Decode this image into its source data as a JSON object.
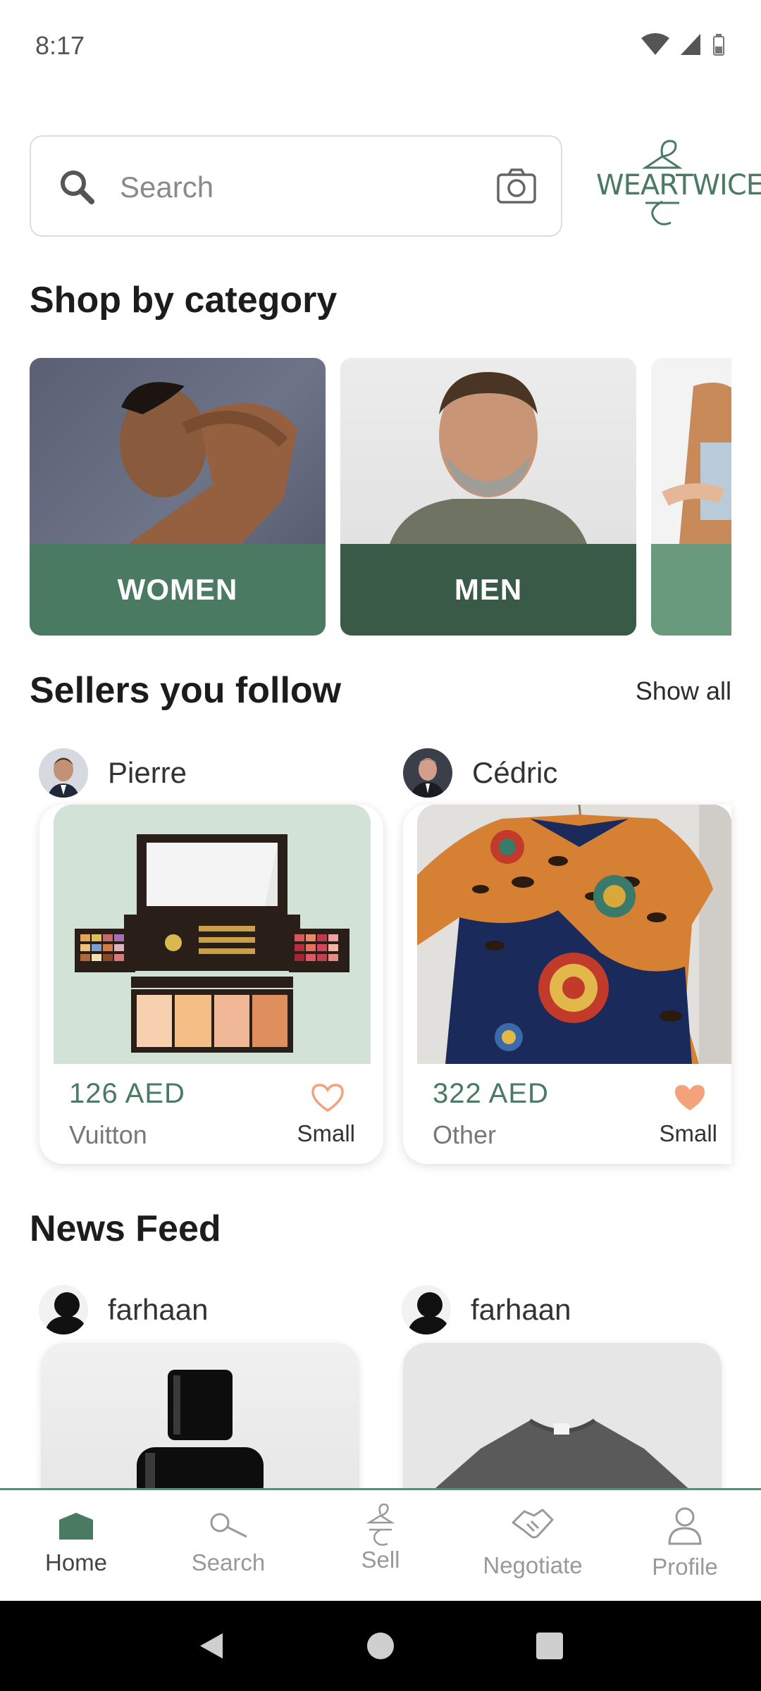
{
  "status_bar": {
    "time": "8:17"
  },
  "search": {
    "placeholder": "Search"
  },
  "logo": {
    "text": "WEARTWICE"
  },
  "sections": {
    "categories_title": "Shop by category",
    "sellers_title": "Sellers you follow",
    "show_all": "Show all",
    "feed_title": "News Feed"
  },
  "categories": [
    {
      "label": "WOMEN",
      "color": "#4a7a62"
    },
    {
      "label": "MEN",
      "color": "#3a5a48"
    },
    {
      "label": "",
      "color": "#6a9a7e"
    }
  ],
  "sellers": [
    {
      "name": "Pierre",
      "price": "126 AED",
      "brand": "Vuitton",
      "size": "Small",
      "favorited": false
    },
    {
      "name": "Cédric",
      "price": "322 AED",
      "brand": "Other",
      "size": "Small",
      "favorited": true
    }
  ],
  "feed": [
    {
      "user": "farhaan",
      "item": "perfume-bottle"
    },
    {
      "user": "farhaan",
      "item": "gray-tshirt"
    }
  ],
  "nav": [
    {
      "label": "Home",
      "icon": "home-icon",
      "active": true
    },
    {
      "label": "Search",
      "icon": "search-icon",
      "active": false
    },
    {
      "label": "Sell",
      "icon": "hanger-icon",
      "active": false
    },
    {
      "label": "Negotiate",
      "icon": "handshake-icon",
      "active": false
    },
    {
      "label": "Profile",
      "icon": "profile-icon",
      "active": false
    }
  ],
  "colors": {
    "brand_green": "#4a7a62",
    "heart": "#f4a27c"
  }
}
